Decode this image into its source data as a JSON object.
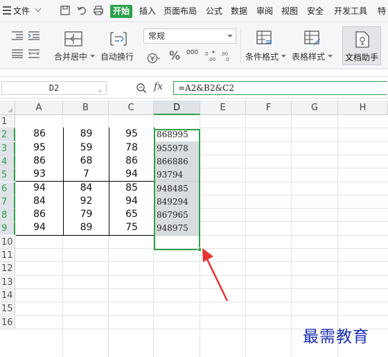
{
  "menubar": {
    "items": [
      "文件",
      "开始",
      "插入",
      "页面布局",
      "公式",
      "数据",
      "审阅",
      "视图",
      "安全",
      "开发工具",
      "特"
    ],
    "active": "开始"
  },
  "ribbon": {
    "merge_center": "合并居中",
    "wrap_text": "自动换行",
    "number_format": "常规",
    "percent_symbol": "%",
    "thousands_symbol": "000",
    "conditional_format": "条件格式",
    "table_style": "表格样式",
    "doc_helper": "文档助手"
  },
  "formula_bar": {
    "name_box": "D2",
    "fx": "fx",
    "formula": "=A2&B2&C2"
  },
  "grid": {
    "columns": [
      "A",
      "B",
      "C",
      "D",
      "E",
      "F",
      "G",
      "H"
    ],
    "rows": [
      "1",
      "2",
      "3",
      "4",
      "5",
      "6",
      "7",
      "8",
      "9",
      "10",
      "11",
      "12",
      "13",
      "14",
      "15",
      "16"
    ],
    "selected_column": "D",
    "data": [
      [
        "86",
        "89",
        "95",
        "868995"
      ],
      [
        "95",
        "59",
        "78",
        "955978"
      ],
      [
        "86",
        "68",
        "86",
        "866886"
      ],
      [
        "93",
        "7",
        "94",
        "93794"
      ],
      [
        "94",
        "84",
        "85",
        "948485"
      ],
      [
        "84",
        "92",
        "94",
        "849294"
      ],
      [
        "86",
        "79",
        "65",
        "867965"
      ],
      [
        "94",
        "89",
        "75",
        "948975"
      ]
    ]
  },
  "annotation": {
    "arrow_color": "#e8342f"
  },
  "watermark": "最需教育",
  "colors": {
    "accent": "#2e9f49"
  }
}
